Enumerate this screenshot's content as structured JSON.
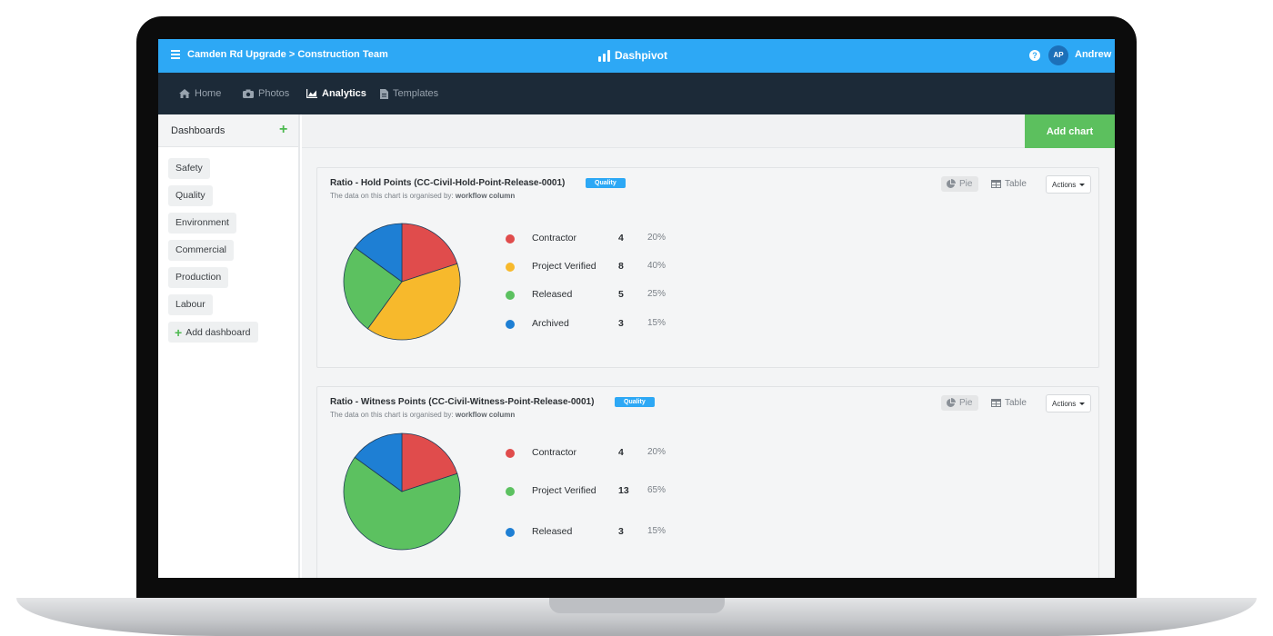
{
  "header": {
    "breadcrumb": "Camden Rd Upgrade > Construction Team",
    "brand": "Dashpivot",
    "user_initials": "AP",
    "user_name": "Andrew",
    "accent_color": "#2da8f5"
  },
  "nav": {
    "items": [
      {
        "label": "Home",
        "icon": "home-icon",
        "active": false
      },
      {
        "label": "Photos",
        "icon": "camera-icon",
        "active": false
      },
      {
        "label": "Analytics",
        "icon": "area-chart-icon",
        "active": true
      },
      {
        "label": "Templates",
        "icon": "file-icon",
        "active": false
      }
    ]
  },
  "sidebar": {
    "title": "Dashboards",
    "items": [
      "Safety",
      "Quality",
      "Environment",
      "Commercial",
      "Production",
      "Labour"
    ],
    "add_label": "Add dashboard"
  },
  "toolbar": {
    "add_chart_label": "Add chart",
    "add_chart_color": "#5cc05e"
  },
  "charts": [
    {
      "title": "Ratio - Hold Points (CC-Civil-Hold-Point-Release-0001)",
      "badge": "Quality",
      "subtitle_prefix": "The data on this chart is organised by:",
      "subtitle_value": "workflow column",
      "pie_label": "Pie",
      "table_label": "Table",
      "actions_label": "Actions",
      "legend": [
        {
          "label": "Contractor",
          "count": "4",
          "pct": "20%",
          "color": "#e04c4c"
        },
        {
          "label": "Project Verified",
          "count": "8",
          "pct": "40%",
          "color": "#f7b92c"
        },
        {
          "label": "Released",
          "count": "5",
          "pct": "25%",
          "color": "#5cc160"
        },
        {
          "label": "Archived",
          "count": "3",
          "pct": "15%",
          "color": "#1e7fd4"
        }
      ]
    },
    {
      "title": "Ratio - Witness Points (CC-Civil-Witness-Point-Release-0001)",
      "badge": "Quality",
      "subtitle_prefix": "The data on this chart is organised by:",
      "subtitle_value": "workflow column",
      "pie_label": "Pie",
      "table_label": "Table",
      "actions_label": "Actions",
      "legend": [
        {
          "label": "Contractor",
          "count": "4",
          "pct": "20%",
          "color": "#e04c4c"
        },
        {
          "label": "Project Verified",
          "count": "13",
          "pct": "65%",
          "color": "#5cc160"
        },
        {
          "label": "Released",
          "count": "3",
          "pct": "15%",
          "color": "#1e7fd4"
        }
      ]
    }
  ],
  "chart_data": [
    {
      "type": "pie",
      "title": "Ratio - Hold Points (CC-Civil-Hold-Point-Release-0001)",
      "categories": [
        "Contractor",
        "Project Verified",
        "Released",
        "Archived"
      ],
      "values": [
        4,
        8,
        5,
        3
      ],
      "colors": [
        "#e04c4c",
        "#f7b92c",
        "#5cc160",
        "#1e7fd4"
      ]
    },
    {
      "type": "pie",
      "title": "Ratio - Witness Points (CC-Civil-Witness-Point-Release-0001)",
      "categories": [
        "Contractor",
        "Project Verified",
        "Released"
      ],
      "values": [
        4,
        13,
        3
      ],
      "colors": [
        "#e04c4c",
        "#5cc160",
        "#1e7fd4"
      ]
    }
  ]
}
